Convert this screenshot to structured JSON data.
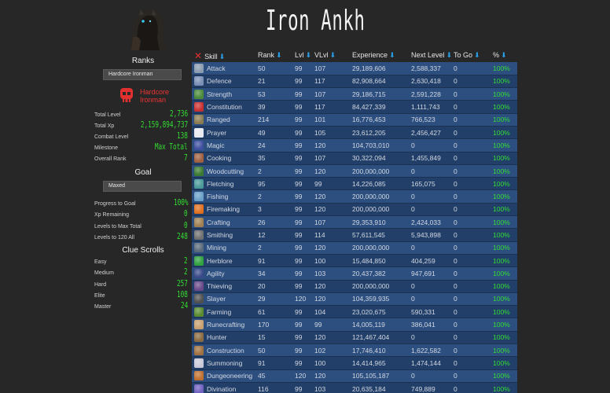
{
  "title": "Iron Ankh",
  "ranks": {
    "heading": "Ranks",
    "select_value": "Hardcore Ironman",
    "badge_text_line1": "Hardcore",
    "badge_text_line2": "Ironman",
    "stats": [
      {
        "label": "Total Level",
        "value": "2,736"
      },
      {
        "label": "Total Xp",
        "value": "2,159,894,737"
      },
      {
        "label": "Combat Level",
        "value": "138"
      },
      {
        "label": "Milestone",
        "value": "Max Total"
      },
      {
        "label": "Overall Rank",
        "value": "7"
      }
    ]
  },
  "goal": {
    "heading": "Goal",
    "select_value": "Maxed",
    "stats": [
      {
        "label": "Progress to Goal",
        "value": "100%"
      },
      {
        "label": "Xp Remaining",
        "value": "0"
      },
      {
        "label": "Levels to Max Total",
        "value": "0"
      },
      {
        "label": "Levels to 120 All",
        "value": "248"
      }
    ]
  },
  "clues": {
    "heading": "Clue Scrolls",
    "stats": [
      {
        "label": "Easy",
        "value": "2"
      },
      {
        "label": "Medium",
        "value": "2"
      },
      {
        "label": "Hard",
        "value": "257"
      },
      {
        "label": "Elite",
        "value": "108"
      },
      {
        "label": "Master",
        "value": "24"
      }
    ]
  },
  "table": {
    "headers": [
      "Skill",
      "Rank",
      "Lvl",
      "VLvl",
      "Experience",
      "Next Level",
      "To Go",
      "%"
    ],
    "rows": [
      {
        "skill": "Attack",
        "rank": "50",
        "lvl": "99",
        "vlvl": "107",
        "xp": "29,189,606",
        "next": "2,588,337",
        "togo": "0",
        "pct": "100%",
        "color": "#8a9cb0"
      },
      {
        "skill": "Defence",
        "rank": "21",
        "lvl": "99",
        "vlvl": "117",
        "xp": "82,908,664",
        "next": "2,630,418",
        "togo": "0",
        "pct": "100%",
        "color": "#7a8fb5"
      },
      {
        "skill": "Strength",
        "rank": "53",
        "lvl": "99",
        "vlvl": "107",
        "xp": "29,186,715",
        "next": "2,591,228",
        "togo": "0",
        "pct": "100%",
        "color": "#4a8a3a"
      },
      {
        "skill": "Constitution",
        "rank": "39",
        "lvl": "99",
        "vlvl": "117",
        "xp": "84,427,339",
        "next": "1,111,743",
        "togo": "0",
        "pct": "100%",
        "color": "#c83030"
      },
      {
        "skill": "Ranged",
        "rank": "214",
        "lvl": "99",
        "vlvl": "101",
        "xp": "16,776,453",
        "next": "766,523",
        "togo": "0",
        "pct": "100%",
        "color": "#8a7a50"
      },
      {
        "skill": "Prayer",
        "rank": "49",
        "lvl": "99",
        "vlvl": "105",
        "xp": "23,612,205",
        "next": "2,456,427",
        "togo": "0",
        "pct": "100%",
        "color": "#e8e8f0"
      },
      {
        "skill": "Magic",
        "rank": "24",
        "lvl": "99",
        "vlvl": "120",
        "xp": "104,703,010",
        "next": "0",
        "togo": "0",
        "pct": "100%",
        "color": "#4050a0"
      },
      {
        "skill": "Cooking",
        "rank": "35",
        "lvl": "99",
        "vlvl": "107",
        "xp": "30,322,094",
        "next": "1,455,849",
        "togo": "0",
        "pct": "100%",
        "color": "#a06040"
      },
      {
        "skill": "Woodcutting",
        "rank": "2",
        "lvl": "99",
        "vlvl": "120",
        "xp": "200,000,000",
        "next": "0",
        "togo": "0",
        "pct": "100%",
        "color": "#3a7a30"
      },
      {
        "skill": "Fletching",
        "rank": "95",
        "lvl": "99",
        "vlvl": "99",
        "xp": "14,226,085",
        "next": "165,075",
        "togo": "0",
        "pct": "100%",
        "color": "#4a9a9a"
      },
      {
        "skill": "Fishing",
        "rank": "2",
        "lvl": "99",
        "vlvl": "120",
        "xp": "200,000,000",
        "next": "0",
        "togo": "0",
        "pct": "100%",
        "color": "#6aa0c8"
      },
      {
        "skill": "Firemaking",
        "rank": "3",
        "lvl": "99",
        "vlvl": "120",
        "xp": "200,000,000",
        "next": "0",
        "togo": "0",
        "pct": "100%",
        "color": "#e07020"
      },
      {
        "skill": "Crafting",
        "rank": "26",
        "lvl": "99",
        "vlvl": "107",
        "xp": "29,353,910",
        "next": "2,424,033",
        "togo": "0",
        "pct": "100%",
        "color": "#a08050"
      },
      {
        "skill": "Smithing",
        "rank": "12",
        "lvl": "99",
        "vlvl": "114",
        "xp": "57,611,545",
        "next": "5,943,898",
        "togo": "0",
        "pct": "100%",
        "color": "#707070"
      },
      {
        "skill": "Mining",
        "rank": "2",
        "lvl": "99",
        "vlvl": "120",
        "xp": "200,000,000",
        "next": "0",
        "togo": "0",
        "pct": "100%",
        "color": "#5a6a7a"
      },
      {
        "skill": "Herblore",
        "rank": "91",
        "lvl": "99",
        "vlvl": "100",
        "xp": "15,484,850",
        "next": "404,259",
        "togo": "0",
        "pct": "100%",
        "color": "#30a040"
      },
      {
        "skill": "Agility",
        "rank": "34",
        "lvl": "99",
        "vlvl": "103",
        "xp": "20,437,382",
        "next": "947,691",
        "togo": "0",
        "pct": "100%",
        "color": "#3a4a8a"
      },
      {
        "skill": "Thieving",
        "rank": "20",
        "lvl": "99",
        "vlvl": "120",
        "xp": "200,000,000",
        "next": "0",
        "togo": "0",
        "pct": "100%",
        "color": "#6a4a8a"
      },
      {
        "skill": "Slayer",
        "rank": "29",
        "lvl": "120",
        "vlvl": "120",
        "xp": "104,359,935",
        "next": "0",
        "togo": "0",
        "pct": "100%",
        "color": "#505050"
      },
      {
        "skill": "Farming",
        "rank": "61",
        "lvl": "99",
        "vlvl": "104",
        "xp": "23,020,675",
        "next": "590,331",
        "togo": "0",
        "pct": "100%",
        "color": "#5a8a30"
      },
      {
        "skill": "Runecrafting",
        "rank": "170",
        "lvl": "99",
        "vlvl": "99",
        "xp": "14,005,119",
        "next": "386,041",
        "togo": "0",
        "pct": "100%",
        "color": "#c8a070"
      },
      {
        "skill": "Hunter",
        "rank": "15",
        "lvl": "99",
        "vlvl": "120",
        "xp": "121,467,404",
        "next": "0",
        "togo": "0",
        "pct": "100%",
        "color": "#8a6a40"
      },
      {
        "skill": "Construction",
        "rank": "50",
        "lvl": "99",
        "vlvl": "102",
        "xp": "17,746,410",
        "next": "1,622,582",
        "togo": "0",
        "pct": "100%",
        "color": "#a07040"
      },
      {
        "skill": "Summoning",
        "rank": "91",
        "lvl": "99",
        "vlvl": "100",
        "xp": "14,414,965",
        "next": "1,474,144",
        "togo": "0",
        "pct": "100%",
        "color": "#c8c8d8"
      },
      {
        "skill": "Dungeoneering",
        "rank": "45",
        "lvl": "120",
        "vlvl": "120",
        "xp": "105,105,187",
        "next": "0",
        "togo": "0",
        "pct": "100%",
        "color": "#c07030"
      },
      {
        "skill": "Divination",
        "rank": "116",
        "lvl": "99",
        "vlvl": "103",
        "xp": "20,635,184",
        "next": "749,889",
        "togo": "0",
        "pct": "100%",
        "color": "#7060c0"
      }
    ]
  }
}
